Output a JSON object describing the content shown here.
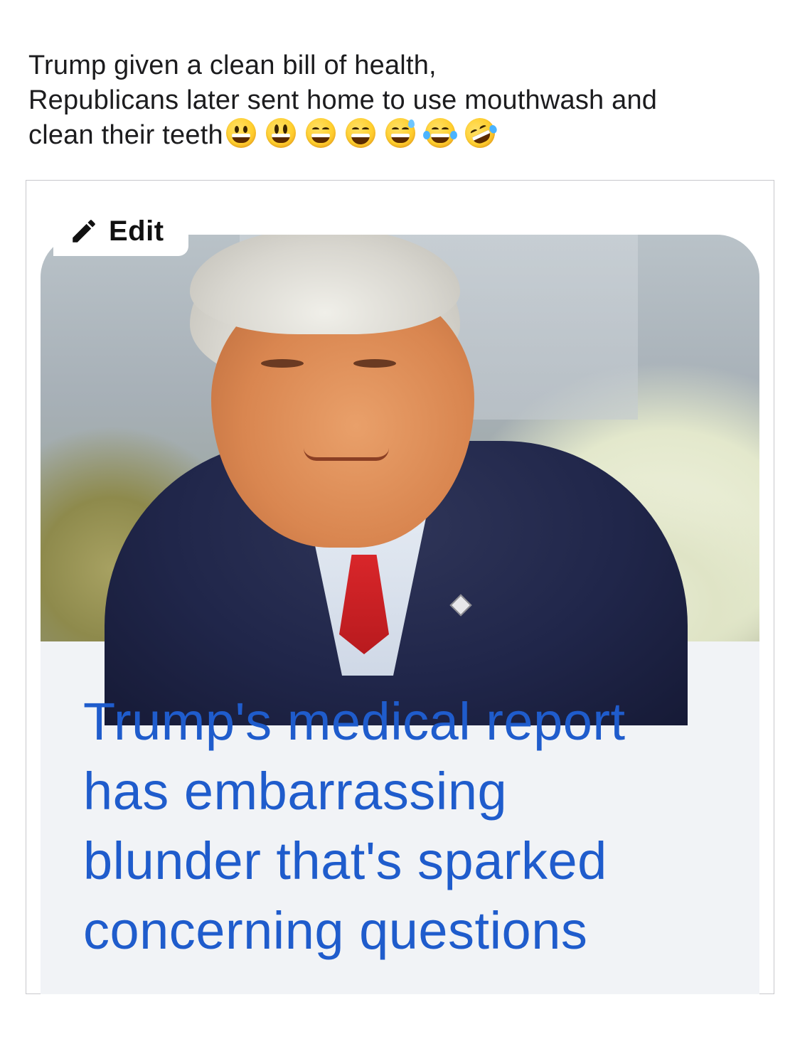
{
  "post": {
    "caption_lines": [
      "Trump given a clean bill of health,",
      "Republicans later sent home to use mouthwash and",
      "clean their teeth"
    ],
    "emojis": [
      "grinning-face-emoji",
      "smiling-face-big-eyes-emoji",
      "grinning-face-smiling-eyes-emoji",
      "beaming-face-emoji",
      "grinning-face-sweat-emoji",
      "face-tears-of-joy-emoji",
      "rolling-on-floor-laughing-emoji"
    ]
  },
  "edit_button": {
    "label": "Edit",
    "icon": "pencil-icon"
  },
  "news_card": {
    "headline_lines": [
      "Trump's medical report",
      "has embarrassing",
      "blunder that's sparked",
      "concerning questions"
    ],
    "headline_color": "#1f5ccc"
  }
}
